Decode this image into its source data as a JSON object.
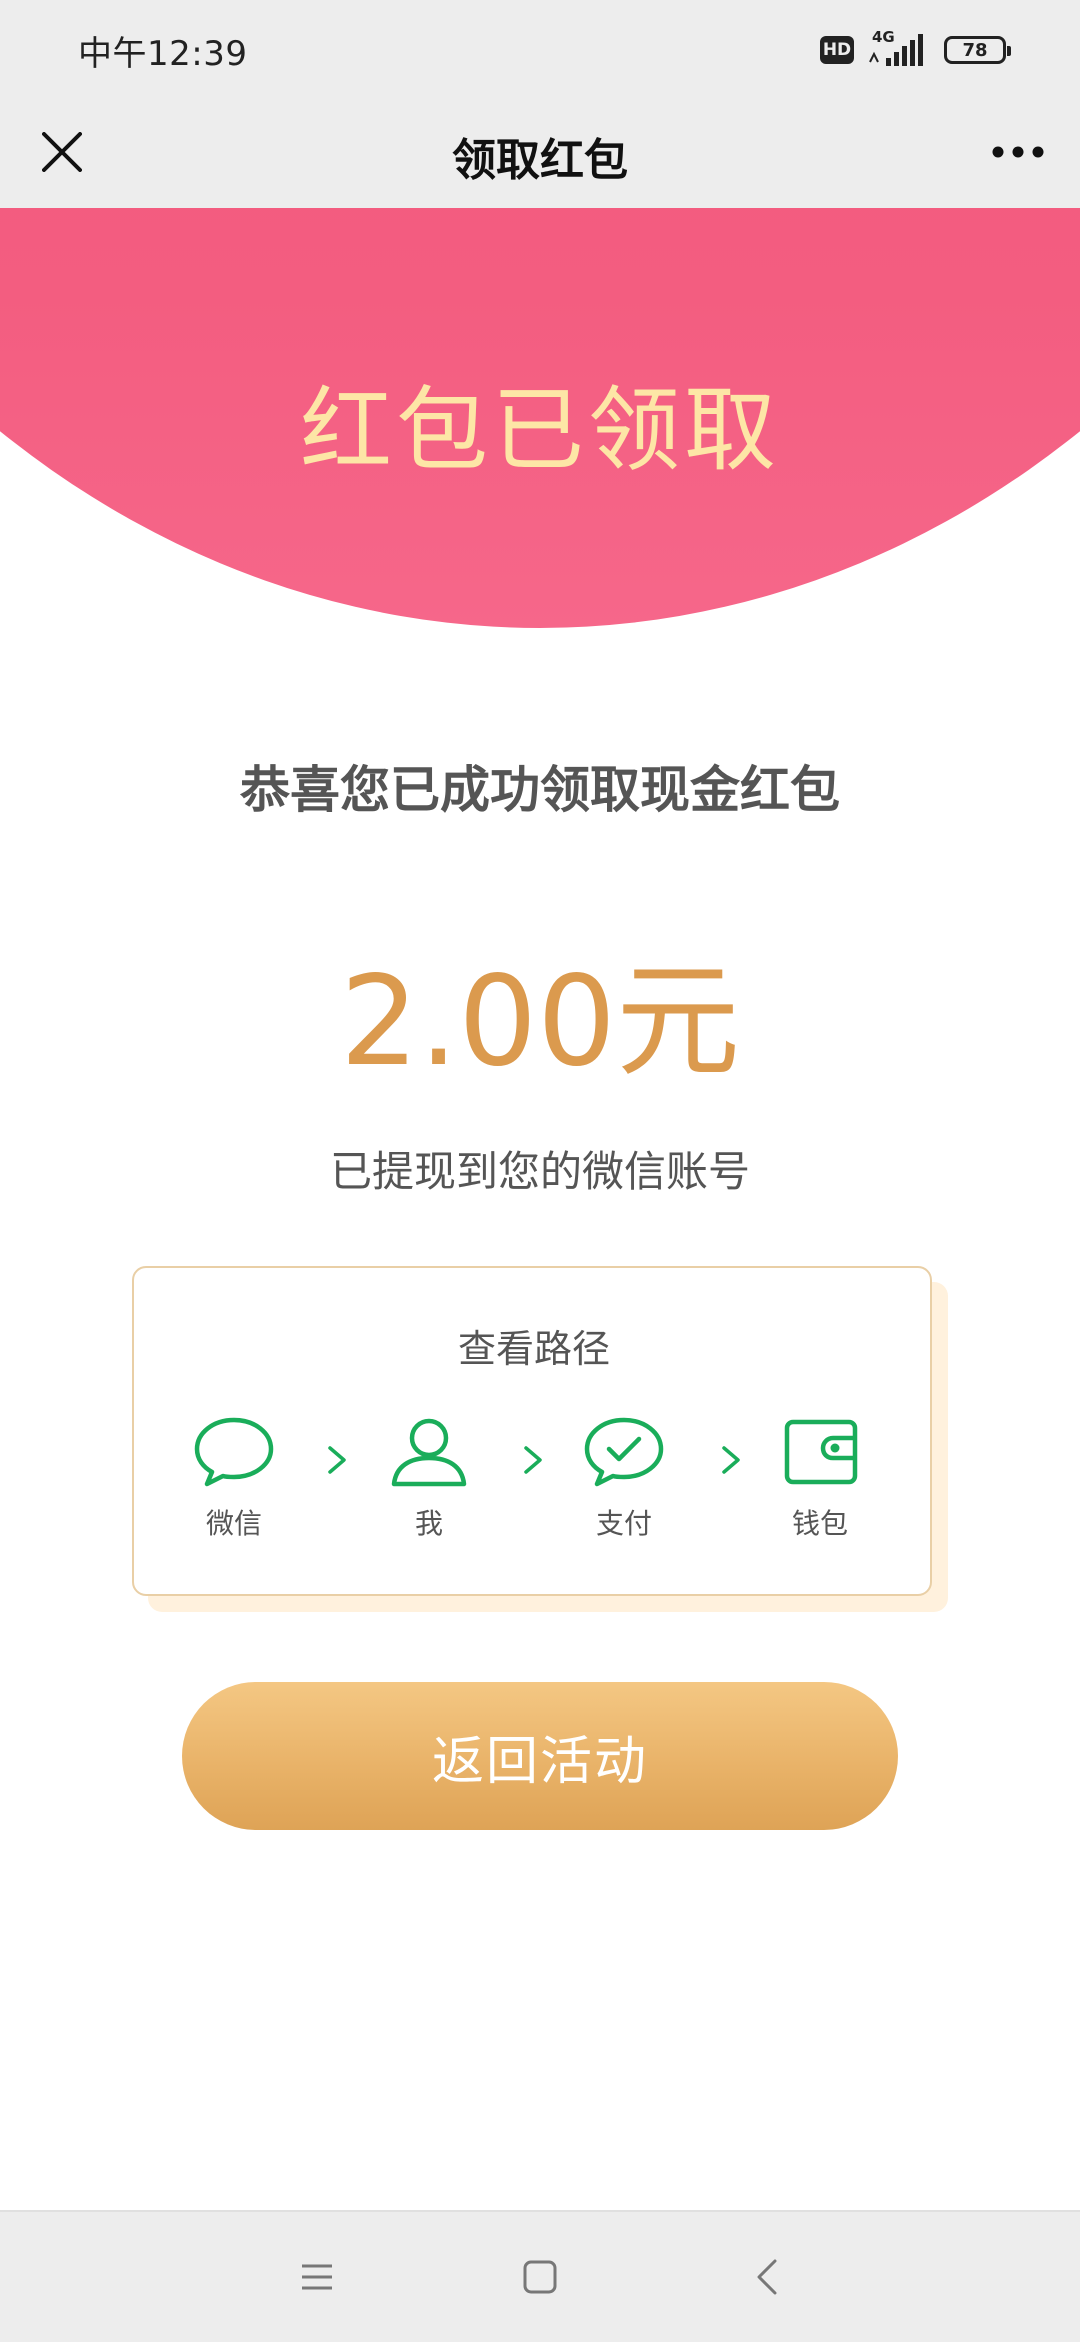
{
  "status_bar": {
    "time": "中午12:39",
    "hd": "HD",
    "network": "4G",
    "battery": "78"
  },
  "nav": {
    "title": "领取红包"
  },
  "banner": {
    "title": "红包已领取"
  },
  "main": {
    "congrats": "恭喜您已成功领取现金红包",
    "amount": "2.00元",
    "note": "已提现到您的微信账号"
  },
  "path": {
    "title": "查看路径",
    "steps": [
      {
        "label": "微信",
        "icon": "chat-bubble-icon"
      },
      {
        "label": "我",
        "icon": "person-icon"
      },
      {
        "label": "支付",
        "icon": "pay-check-icon"
      },
      {
        "label": "钱包",
        "icon": "wallet-icon"
      }
    ]
  },
  "actions": {
    "return_label": "返回活动"
  },
  "colors": {
    "banner": "#f34a72",
    "banner_text": "#fde6a6",
    "amount": "#db9a4e",
    "icon_green": "#1aad5a",
    "button": "#e9b369"
  }
}
